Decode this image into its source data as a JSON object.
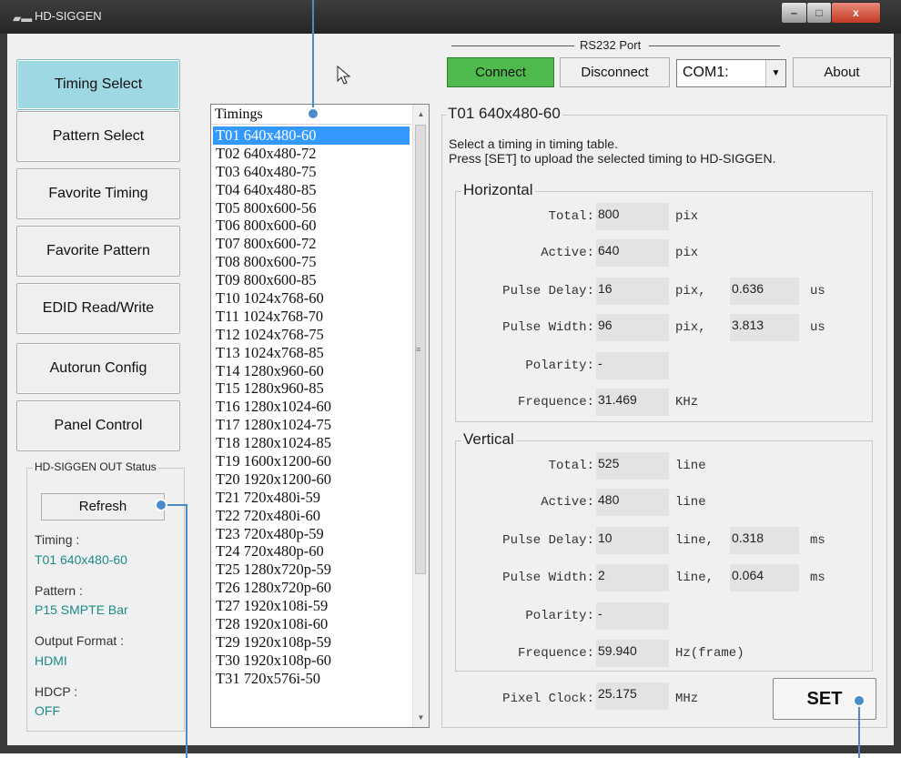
{
  "window": {
    "title": "HD-SIGGEN",
    "min_glyph": "‒",
    "max_glyph": "□",
    "close_glyph": "x"
  },
  "nav": {
    "items": [
      {
        "label": "Timing Select",
        "active": true
      },
      {
        "label": "Pattern Select"
      },
      {
        "label": "Favorite Timing"
      },
      {
        "label": "Favorite Pattern"
      },
      {
        "label": "EDID Read/Write"
      },
      {
        "label": "Autorun Config"
      },
      {
        "label": "Panel Control"
      }
    ]
  },
  "status": {
    "group_title": "HD-SIGGEN OUT Status",
    "refresh_label": "Refresh",
    "timing_label": "Timing :",
    "timing_value": "T01 640x480-60",
    "pattern_label": "Pattern :",
    "pattern_value": "P15 SMPTE Bar",
    "format_label": "Output Format :",
    "format_value": "HDMI",
    "hdcp_label": "HDCP :",
    "hdcp_value": "OFF"
  },
  "rs232": {
    "title": "RS232 Port",
    "connect_label": "Connect",
    "disconnect_label": "Disconnect",
    "port_value": "COM1:",
    "about_label": "About"
  },
  "timings": {
    "header": "Timings",
    "items": [
      "T01 640x480-60",
      "T02 640x480-72",
      "T03 640x480-75",
      "T04 640x480-85",
      "T05 800x600-56",
      "T06 800x600-60",
      "T07 800x600-72",
      "T08 800x600-75",
      "T09 800x600-85",
      "T10 1024x768-60",
      "T11 1024x768-70",
      "T12 1024x768-75",
      "T13 1024x768-85",
      "T14 1280x960-60",
      "T15 1280x960-85",
      "T16 1280x1024-60",
      "T17 1280x1024-75",
      "T18 1280x1024-85",
      "T19 1600x1200-60",
      "T20 1920x1200-60",
      "T21 720x480i-59",
      "T22 720x480i-60",
      "T23 720x480p-59",
      "T24 720x480p-60",
      "T25 1280x720p-59",
      "T26 1280x720p-60",
      "T27 1920x108i-59",
      "T28 1920x108i-60",
      "T29 1920x108p-59",
      "T30 1920x108p-60",
      "T31 720x576i-50"
    ],
    "selected_index": 0
  },
  "detail": {
    "title": "T01 640x480-60",
    "desc1": "Select a timing in timing table.",
    "desc2": "Press [SET] to upload the selected timing to HD-SIGGEN.",
    "horizontal": {
      "title": "Horizontal",
      "total_label": "Total:",
      "total": "800",
      "total_unit": "pix",
      "active_label": "Active:",
      "active": "640",
      "active_unit": "pix",
      "pdelay_label": "Pulse Delay:",
      "pdelay": "16",
      "pdelay_unit": "pix,",
      "pdelay_time": "0.636",
      "pdelay_time_unit": "us",
      "pwidth_label": "Pulse Width:",
      "pwidth": "96",
      "pwidth_unit": "pix,",
      "pwidth_time": "3.813",
      "pwidth_time_unit": "us",
      "polarity_label": "Polarity:",
      "polarity": "-",
      "freq_label": "Frequence:",
      "freq": "31.469",
      "freq_unit": "KHz"
    },
    "vertical": {
      "title": "Vertical",
      "total_label": "Total:",
      "total": "525",
      "total_unit": "line",
      "active_label": "Active:",
      "active": "480",
      "active_unit": "line",
      "pdelay_label": "Pulse Delay:",
      "pdelay": "10",
      "pdelay_unit": "line,",
      "pdelay_time": "0.318",
      "pdelay_time_unit": "ms",
      "pwidth_label": "Pulse Width:",
      "pwidth": "2",
      "pwidth_unit": "line,",
      "pwidth_time": "0.064",
      "pwidth_time_unit": "ms",
      "polarity_label": "Polarity:",
      "polarity": "-",
      "freq_label": "Frequence:",
      "freq": "59.940",
      "freq_unit": "Hz(frame)"
    },
    "pixel_clock_label": "Pixel Clock:",
    "pixel_clock": "25.175",
    "pixel_clock_unit": "MHz",
    "set_label": "SET"
  }
}
